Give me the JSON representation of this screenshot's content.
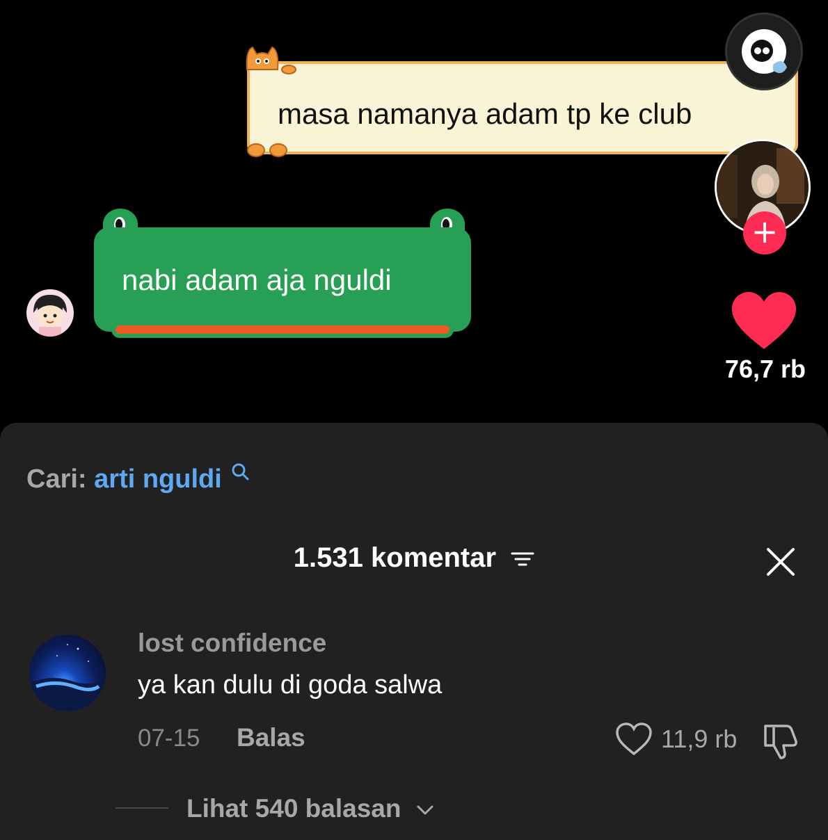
{
  "video": {
    "caption_top": "masa namanya adam tp ke club",
    "caption_bottom": "nabi adam aja nguldi",
    "like_count": "76,7 rb",
    "follow_symbol": "+"
  },
  "sheet": {
    "search_label": "Cari:",
    "search_term": "arti nguldi",
    "comment_count_title": "1.531 komentar"
  },
  "comment": {
    "username": "lost confidence",
    "text": "ya kan dulu di goda salwa",
    "date": "07-15",
    "reply_label": "Balas",
    "like_count": "11,9 rb",
    "view_replies": "Lihat 540 balasan"
  },
  "colors": {
    "like_red": "#fe2c55",
    "link_blue": "#5fa8f2",
    "sheet_bg": "#212121"
  }
}
